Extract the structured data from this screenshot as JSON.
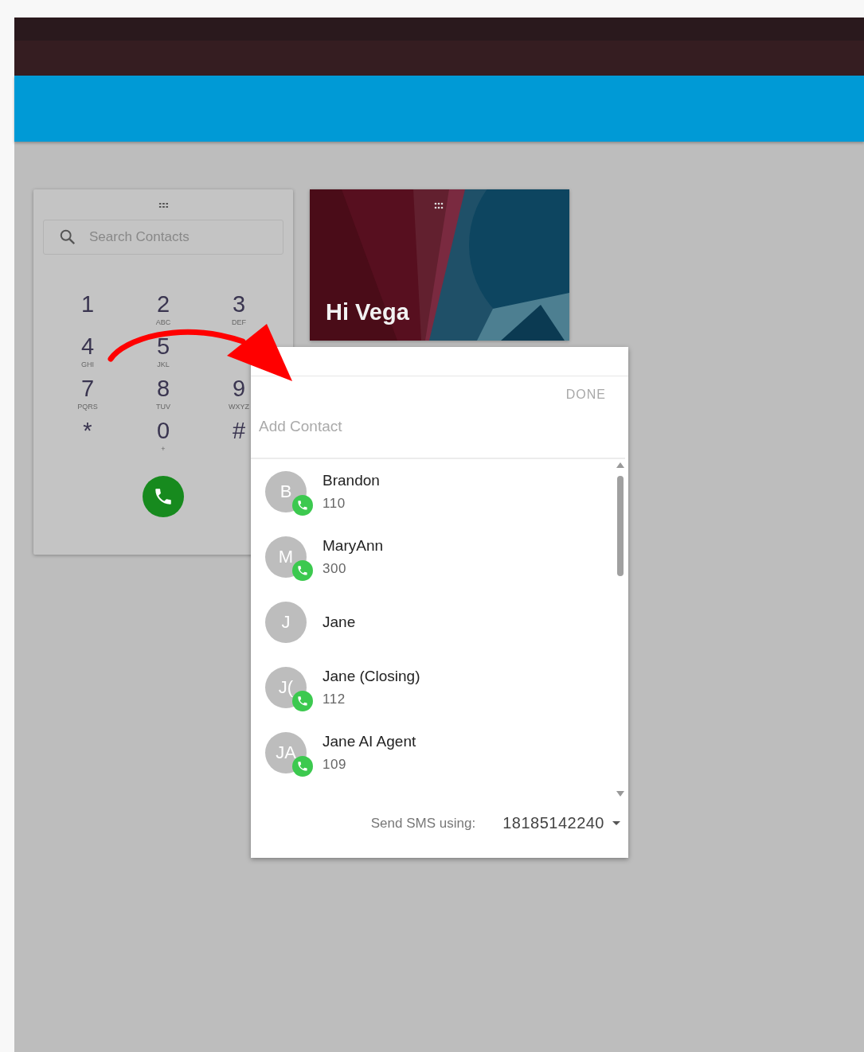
{
  "dialer": {
    "search": {
      "placeholder": "Search Contacts"
    },
    "keys": [
      {
        "kind": "key",
        "digit": "1"
      },
      {
        "kind": "key",
        "digit": "2",
        "letters": "ABC"
      },
      {
        "kind": "key",
        "digit": "3",
        "letters": "DEF"
      },
      {
        "kind": "key",
        "digit": "4",
        "letters": "GHI"
      },
      {
        "kind": "key",
        "digit": "5",
        "letters": "JKL"
      },
      {
        "kind": "covered"
      },
      {
        "kind": "key",
        "digit": "7",
        "letters": "PQRS"
      },
      {
        "kind": "key",
        "digit": "8",
        "letters": "TUV"
      },
      {
        "kind": "key",
        "digit": "9",
        "letters": "WXYZ"
      },
      {
        "kind": "key",
        "digit": "*"
      },
      {
        "kind": "key",
        "digit": "0",
        "letters": "+"
      },
      {
        "kind": "key",
        "digit": "#"
      }
    ]
  },
  "greeting": {
    "title": "Hi Vega"
  },
  "popup": {
    "done": "DONE",
    "add_contact": {
      "placeholder": "Add Contact"
    },
    "contacts": [
      {
        "initials": "B",
        "name": "Brandon",
        "extension": "110",
        "phone": true
      },
      {
        "initials": "M",
        "name": "MaryAnn",
        "extension": "300",
        "phone": true
      },
      {
        "initials": "J",
        "name": "Jane",
        "phone": false
      },
      {
        "initials": "J(",
        "name": "Jane (Closing)",
        "extension": "112",
        "phone": true
      },
      {
        "initials": "JA",
        "name": "Jane AI Agent",
        "extension": "109",
        "phone": true
      }
    ],
    "sms_label": "Send SMS using:",
    "sms_number": "18185142240"
  }
}
